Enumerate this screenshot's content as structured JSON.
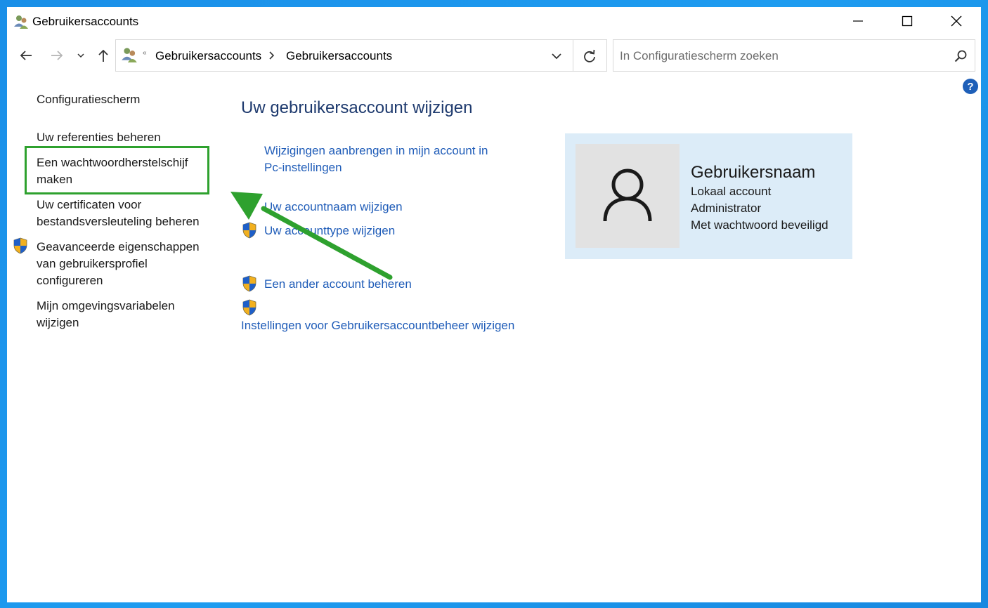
{
  "window": {
    "title": "Gebruikersaccounts"
  },
  "nav": {
    "breadcrumb": [
      "Gebruikersaccounts",
      "Gebruikersaccounts"
    ],
    "search_placeholder": "In Configuratiescherm zoeken",
    "help_label": "?"
  },
  "sidebar": {
    "home": "Configuratiescherm",
    "items": [
      {
        "label": "Uw referenties beheren"
      },
      {
        "label": "Een wachtwoordherstelschijf",
        "label2": "maken"
      },
      {
        "label": "Uw certificaten voor",
        "label2": "bestandsversleuteling beheren"
      },
      {
        "label": "Geavanceerde eigenschappen",
        "label2": "van gebruikersprofiel",
        "label3": "configureren"
      },
      {
        "label": "Mijn omgevingsvariabelen",
        "label2": "wijzigen"
      }
    ]
  },
  "main": {
    "title": "Uw gebruikersaccount wijzigen",
    "links": [
      {
        "label": "Wijzigingen aanbrengen in mijn account in",
        "label2": "Pc-instellingen"
      },
      {
        "label": "Uw accountnaam wijzigen"
      },
      {
        "label": "Uw accounttype wijzigen"
      },
      {
        "label": "Een ander account beheren"
      },
      {
        "label": "Instellingen voor Gebruikersaccountbeheer wijzigen"
      }
    ]
  },
  "user": {
    "name": "Gebruikersnaam",
    "type": "Lokaal account",
    "role": "Administrator",
    "protection": "Met wachtwoord beveiligd"
  },
  "colors": {
    "link": "#1f5cb8",
    "title": "#1e3a6e",
    "highlight": "#2ea12e",
    "card": "#dcecf8"
  }
}
